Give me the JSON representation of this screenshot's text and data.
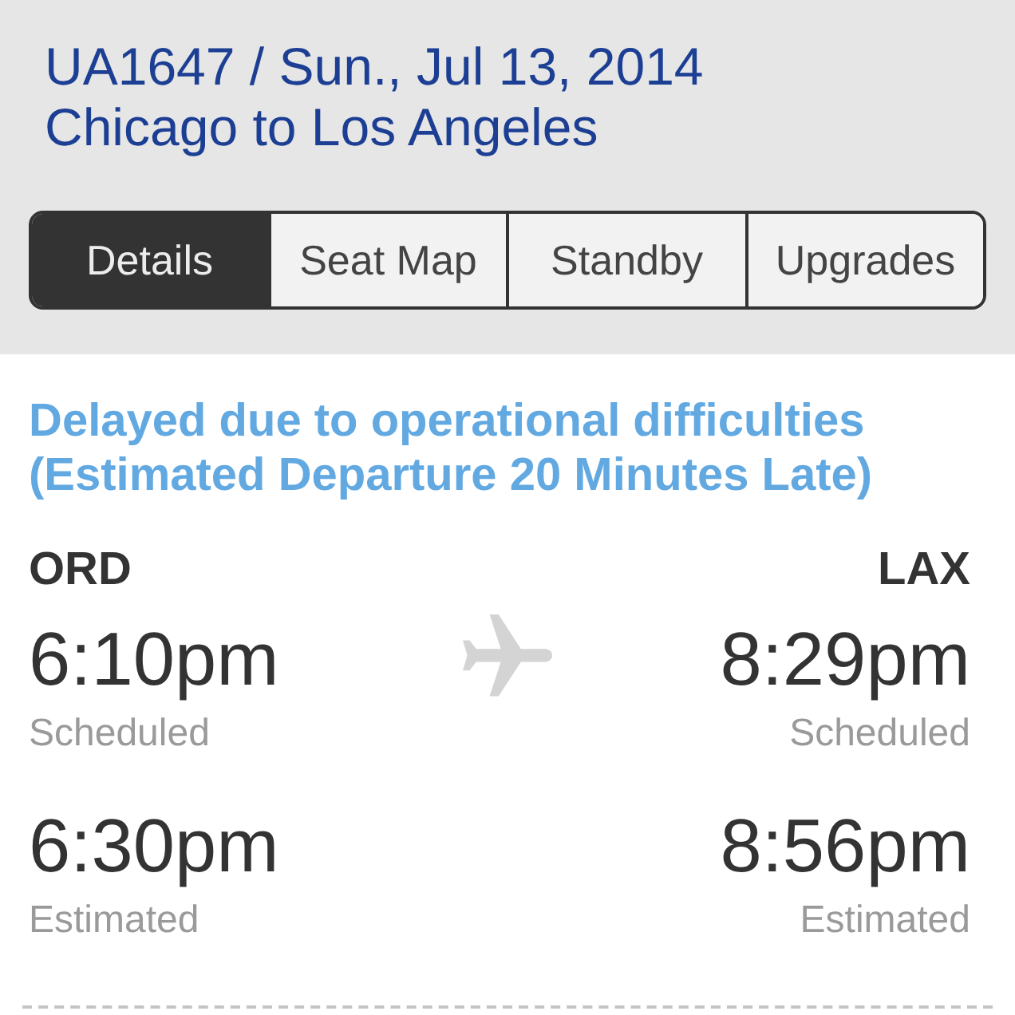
{
  "header": {
    "title": "UA1647 / Sun., Jul 13, 2014",
    "route": "Chicago to Los Angeles"
  },
  "tabs": [
    {
      "label": "Details",
      "selected": true
    },
    {
      "label": "Seat Map",
      "selected": false
    },
    {
      "label": "Standby",
      "selected": false
    },
    {
      "label": "Upgrades",
      "selected": false
    }
  ],
  "status": {
    "lines": [
      "Delayed due to operational difficulties",
      "(Estimated Departure 20 Minutes Late)"
    ]
  },
  "origin": {
    "code": "ORD"
  },
  "destination": {
    "code": "LAX"
  },
  "times": [
    {
      "departure": {
        "time": "6:10pm",
        "label": "Scheduled"
      },
      "arrival": {
        "time": "8:29pm",
        "label": "Scheduled"
      }
    },
    {
      "departure": {
        "time": "6:30pm",
        "label": "Estimated"
      },
      "arrival": {
        "time": "8:56pm",
        "label": "Estimated"
      }
    }
  ]
}
